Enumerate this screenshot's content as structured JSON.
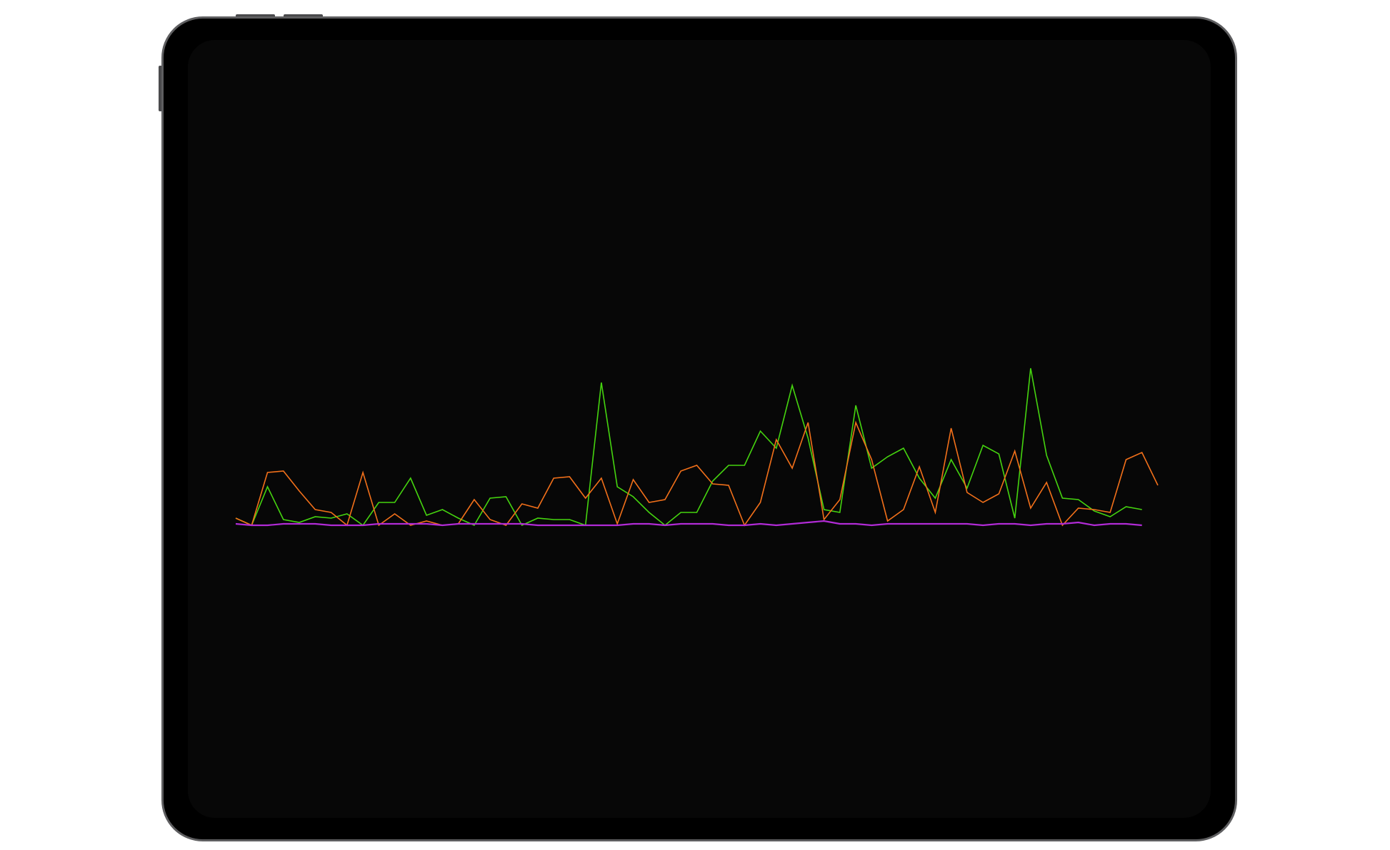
{
  "chart_data": {
    "type": "line",
    "title": "",
    "xlabel": "",
    "ylabel": "",
    "x": [
      0,
      1,
      2,
      3,
      4,
      5,
      6,
      7,
      8,
      9,
      10,
      11,
      12,
      13,
      14,
      15,
      16,
      17,
      18,
      19,
      20,
      21,
      22,
      23,
      24,
      25,
      26,
      27,
      28,
      29,
      30,
      31,
      32,
      33,
      34,
      35,
      36,
      37,
      38,
      39,
      40,
      41,
      42,
      43,
      44,
      45,
      46,
      47,
      48,
      49,
      50,
      51,
      52,
      53,
      54,
      55,
      56,
      57,
      58
    ],
    "xlim": [
      0,
      58
    ],
    "ylim": [
      0,
      100
    ],
    "grid": false,
    "legend": "none",
    "series": [
      {
        "color": "#45d40f",
        "values": [
          5,
          0,
          27,
          4,
          2,
          6,
          5,
          8,
          0,
          16,
          16,
          33,
          7,
          11,
          5,
          0,
          19,
          20,
          0,
          5,
          4,
          4,
          0,
          100,
          27,
          20,
          9,
          0,
          9,
          9,
          31,
          42,
          42,
          66,
          54,
          98,
          61,
          11,
          9,
          84,
          40,
          48,
          54,
          33,
          19,
          46,
          26,
          56,
          50,
          5,
          110,
          49,
          19,
          18,
          10,
          6,
          13,
          11
        ]
      },
      {
        "color": "#f2701a",
        "values": [
          5,
          0,
          37,
          38,
          24,
          11,
          9,
          0,
          37,
          0,
          8,
          0,
          3,
          0,
          1,
          18,
          4,
          0,
          15,
          12,
          33,
          34,
          19,
          33,
          1,
          32,
          16,
          18,
          38,
          42,
          29,
          28,
          0,
          16,
          60,
          40,
          72,
          4,
          18,
          72,
          46,
          3,
          11,
          41,
          9,
          68,
          23,
          16,
          22,
          52,
          12,
          30,
          0,
          12,
          11,
          9,
          46,
          51,
          28
        ]
      },
      {
        "color": "#b12bd6",
        "values": [
          1,
          0,
          0,
          1,
          1,
          1,
          0,
          0,
          0,
          1,
          1,
          1,
          1,
          0,
          1,
          1,
          1,
          1,
          1,
          0,
          0,
          0,
          0,
          0,
          0,
          1,
          1,
          0,
          1,
          1,
          1,
          0,
          0,
          1,
          0,
          1,
          2,
          3,
          1,
          1,
          0,
          1,
          1,
          1,
          1,
          1,
          1,
          0,
          1,
          1,
          0,
          1,
          1,
          2,
          0,
          1,
          1,
          0
        ]
      }
    ]
  }
}
